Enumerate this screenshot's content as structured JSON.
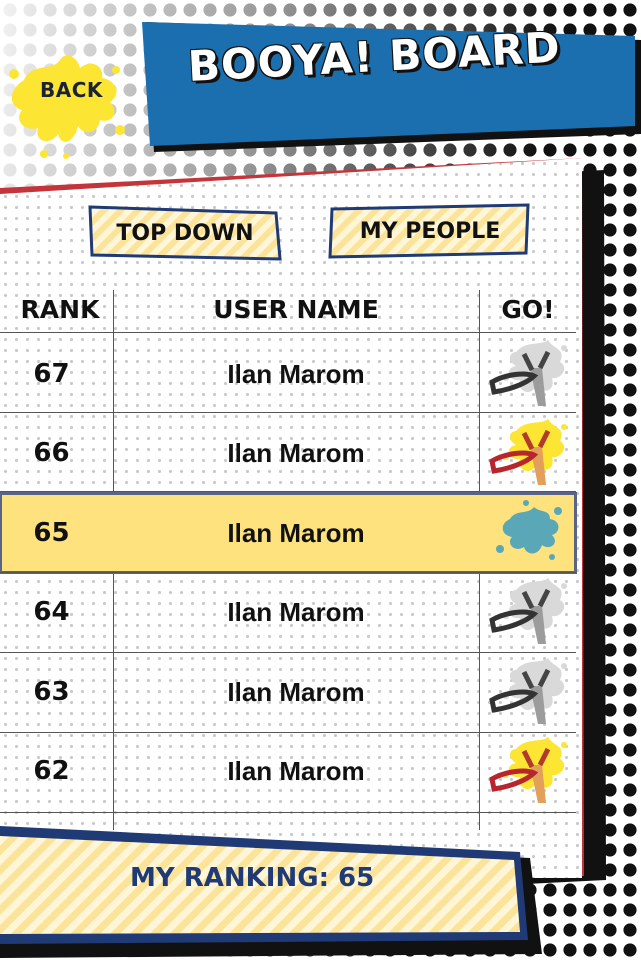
{
  "header": {
    "title": "BOOYA! BOARD",
    "back_label": "BACK"
  },
  "filters": [
    {
      "label": "TOP DOWN"
    },
    {
      "label": "MY PEOPLE"
    }
  ],
  "table": {
    "columns": [
      "RANK",
      "USER NAME",
      "GO!"
    ],
    "rows": [
      {
        "rank": "67",
        "name": "Ilan Marom",
        "action": "slingshot-gray-icon"
      },
      {
        "rank": "66",
        "name": "Ilan Marom",
        "action": "slingshot-color-icon"
      },
      {
        "rank": "65",
        "name": "Ilan Marom",
        "action": "splat-blue-icon",
        "highlighted": true
      },
      {
        "rank": "64",
        "name": "Ilan Marom",
        "action": "slingshot-gray-icon"
      },
      {
        "rank": "63",
        "name": "Ilan Marom",
        "action": "slingshot-gray-icon"
      },
      {
        "rank": "62",
        "name": "Ilan Marom",
        "action": "slingshot-color-icon"
      }
    ]
  },
  "footer": {
    "ranking_label": "MY RANKING: 65"
  },
  "colors": {
    "title_blue": "#1b6fae",
    "navy": "#1f3a75",
    "card_red": "#c4343b",
    "highlight_yellow": "#fde27e",
    "splat_yellow": "#fde534",
    "splat_blue": "#5aa7b8"
  }
}
